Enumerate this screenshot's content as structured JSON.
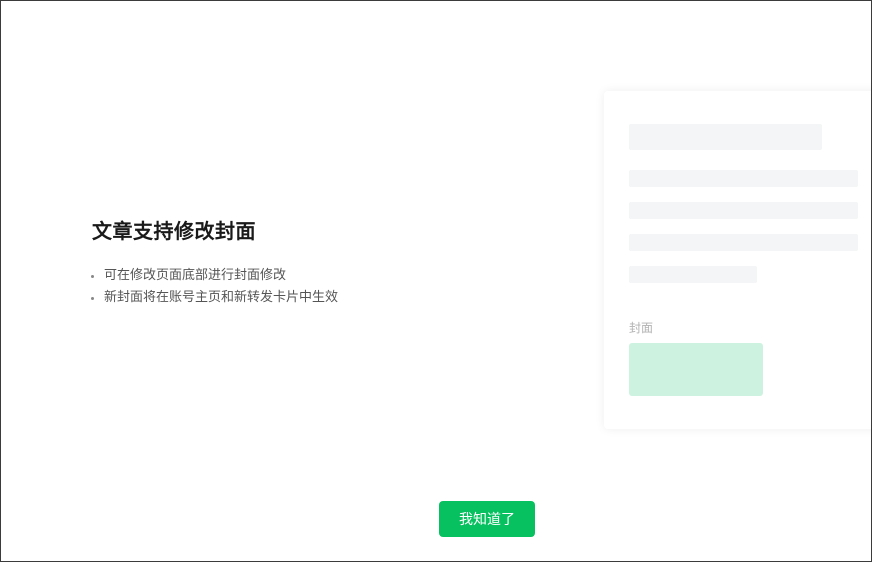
{
  "dialog": {
    "title": "文章支持修改封面",
    "bullets": [
      "可在修改页面底部进行封面修改",
      "新封面将在账号主页和新转发卡片中生效"
    ],
    "preview": {
      "cover_label": "封面",
      "cover_color": "#cdf3e0"
    },
    "confirm_label": "我知道了",
    "accent_color": "#07c160"
  }
}
